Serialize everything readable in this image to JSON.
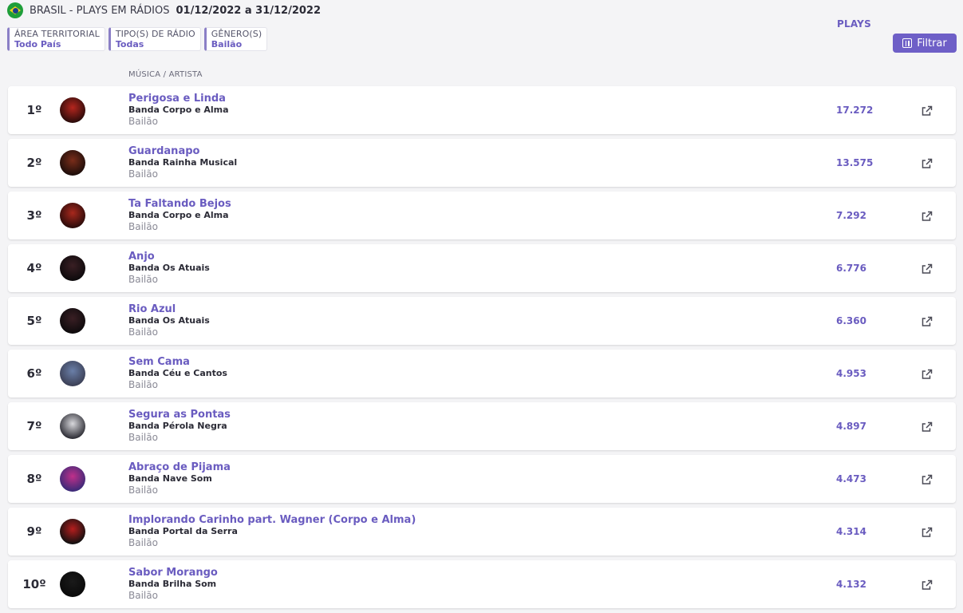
{
  "header": {
    "country": "BRASIL",
    "title": "BRASIL - PLAYS EM RÁDIOS",
    "date_range": "01/12/2022 a 31/12/2022"
  },
  "filters": [
    {
      "label": "ÁREA TERRITORIAL",
      "value": "Todo País"
    },
    {
      "label": "TIPO(S) DE RÁDIO",
      "value": "Todas"
    },
    {
      "label": "GÊNERO(S)",
      "value": "Bailão"
    }
  ],
  "filter_button": {
    "label": "Filtrar",
    "icon": "sliders-icon"
  },
  "columns": {
    "music": "MÚSICA / ARTISTA",
    "plays": "PLAYS"
  },
  "colors": {
    "accent": "#6a5cc0",
    "button": "#6e5fc7",
    "background": "#f4f4f6"
  },
  "rows": [
    {
      "rank": "1º",
      "song": "Perigosa e Linda",
      "artist": "Banda Corpo e Alma",
      "genre": "Bailão",
      "plays": "17.272"
    },
    {
      "rank": "2º",
      "song": "Guardanapo",
      "artist": "Banda Rainha Musical",
      "genre": "Bailão",
      "plays": "13.575"
    },
    {
      "rank": "3º",
      "song": "Ta Faltando Bejos",
      "artist": "Banda Corpo e Alma",
      "genre": "Bailão",
      "plays": "7.292"
    },
    {
      "rank": "4º",
      "song": "Anjo",
      "artist": "Banda Os Atuais",
      "genre": "Bailão",
      "plays": "6.776"
    },
    {
      "rank": "5º",
      "song": "Rio Azul",
      "artist": "Banda Os Atuais",
      "genre": "Bailão",
      "plays": "6.360"
    },
    {
      "rank": "6º",
      "song": "Sem Cama",
      "artist": "Banda Céu e Cantos",
      "genre": "Bailão",
      "plays": "4.953"
    },
    {
      "rank": "7º",
      "song": "Segura as Pontas",
      "artist": "Banda Pérola Negra",
      "genre": "Bailão",
      "plays": "4.897"
    },
    {
      "rank": "8º",
      "song": "Abraço de Pijama",
      "artist": "Banda Nave Som",
      "genre": "Bailão",
      "plays": "4.473"
    },
    {
      "rank": "9º",
      "song": "Implorando Carinho part. Wagner (Corpo e Alma)",
      "artist": "Banda Portal da Serra",
      "genre": "Bailão",
      "plays": "4.314"
    },
    {
      "rank": "10º",
      "song": "Sabor Morango",
      "artist": "Banda Brilha Som",
      "genre": "Bailão",
      "plays": "4.132"
    }
  ]
}
